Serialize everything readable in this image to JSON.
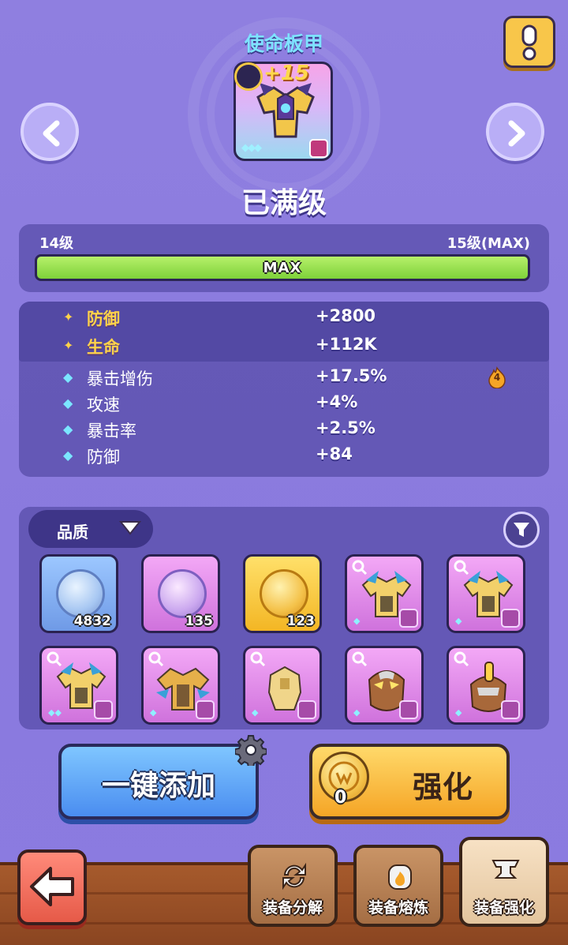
{
  "header": {
    "item_name": "使命板甲",
    "enhance_level": "+15",
    "status": "已满级"
  },
  "level": {
    "current_label": "14级",
    "max_label": "15级(MAX)",
    "bar_text": "MAX",
    "progress": 1.0
  },
  "stats": {
    "main": [
      {
        "name": "防御",
        "value": "+2800"
      },
      {
        "name": "生命",
        "value": "+112K"
      }
    ],
    "sub": [
      {
        "name": "暴击增伤",
        "value": "+17.5%"
      },
      {
        "name": "攻速",
        "value": "+4%"
      },
      {
        "name": "暴击率",
        "value": "+2.5%"
      },
      {
        "name": "防御",
        "value": "+84"
      }
    ],
    "flame_badge": "4"
  },
  "inventory": {
    "sort_label": "品质",
    "tiles": [
      {
        "kind": "coin",
        "color": "blue",
        "qty": "4832"
      },
      {
        "kind": "coin",
        "color": "purple",
        "qty": "135"
      },
      {
        "kind": "coin",
        "color": "gold",
        "qty": "123"
      },
      {
        "kind": "equip",
        "icon": "armor-icon"
      },
      {
        "kind": "equip",
        "icon": "armor-icon"
      },
      {
        "kind": "equip",
        "icon": "armor-icon"
      },
      {
        "kind": "equip",
        "icon": "armor-icon"
      },
      {
        "kind": "equip",
        "icon": "armor-icon"
      },
      {
        "kind": "equip",
        "icon": "helmet-icon"
      },
      {
        "kind": "equip",
        "icon": "helmet-icon"
      }
    ]
  },
  "actions": {
    "auto_add": "一键添加",
    "enhance": "强化",
    "enhance_cost": "0"
  },
  "nav": {
    "items": [
      {
        "label": "装备分解"
      },
      {
        "label": "装备熔炼"
      },
      {
        "label": "装备强化"
      }
    ]
  },
  "colors": {
    "background": "#8f7fe0",
    "accent_gold": "#ffd24a",
    "accent_cyan": "#7ee3ff",
    "progress_green": "#7ed23a"
  }
}
